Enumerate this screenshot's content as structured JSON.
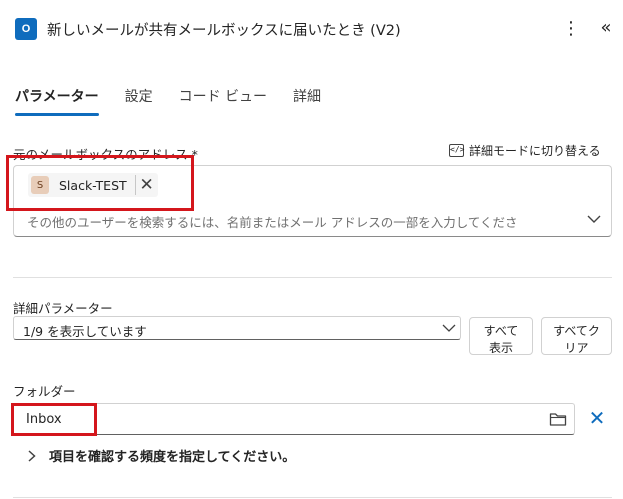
{
  "header": {
    "app_icon_text": "O",
    "title": "新しいメールが共有メールボックスに届いたとき (V2)",
    "more_glyph": "⋮",
    "collapse_glyph": "«"
  },
  "tabs": [
    {
      "label": "パラメーター",
      "active": true
    },
    {
      "label": "設定",
      "active": false
    },
    {
      "label": "コード ビュー",
      "active": false
    },
    {
      "label": "詳細",
      "active": false
    }
  ],
  "mailbox": {
    "label": "元のメールボックスのアドレス *",
    "advanced_mode_label": "詳細モードに切り替える",
    "chip": {
      "avatar": "S",
      "text": "Slack-TEST",
      "remove_glyph": "✕"
    },
    "placeholder": "その他のユーザーを検索するには、名前またはメール アドレスの一部を入力してくださ"
  },
  "advanced": {
    "label": "詳細パラメーター",
    "selected": "1/9 を表示しています",
    "show_all_line1": "すべて",
    "show_all_line2": "表示",
    "clear_all_line1": "すべてク",
    "clear_all_line2": "リア"
  },
  "folder": {
    "label": "フォルダー",
    "value": "Inbox",
    "clear_glyph": "✕"
  },
  "frequency": {
    "label": "項目を確認する頻度を指定してください。"
  },
  "colors": {
    "accent": "#0f6cbd",
    "highlight": "#d4161c"
  }
}
